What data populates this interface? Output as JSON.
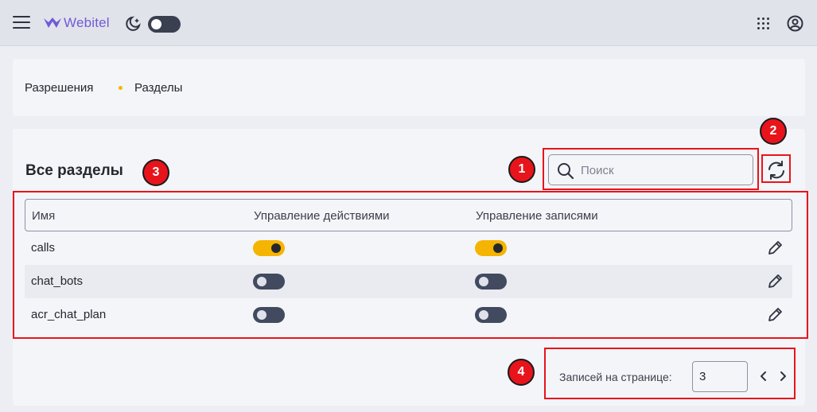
{
  "app": {
    "logo_text": "Webitel"
  },
  "breadcrumb": [
    "Разрешения",
    "Разделы"
  ],
  "page": {
    "title": "Все разделы"
  },
  "search": {
    "placeholder": "Поиск",
    "value": ""
  },
  "table": {
    "columns": [
      "Имя",
      "Управление действиями",
      "Управление записями"
    ],
    "rows": [
      {
        "name": "calls",
        "actions_enabled": true,
        "records_enabled": true
      },
      {
        "name": "chat_bots",
        "actions_enabled": false,
        "records_enabled": false
      },
      {
        "name": "acr_chat_plan",
        "actions_enabled": false,
        "records_enabled": false
      }
    ]
  },
  "pagination": {
    "label": "Записей на странице:",
    "per_page": "3"
  },
  "annotations": [
    "1",
    "2",
    "3",
    "4"
  ],
  "colors": {
    "accent": "#f5b400",
    "brand": "#6e5bd6",
    "annotation": "#e8141b",
    "switch_off": "#414a5e"
  },
  "icons": [
    "menu-icon",
    "webitel-logo-icon",
    "theme-moon-icon",
    "apps-grid-icon",
    "account-icon",
    "search-icon",
    "refresh-icon",
    "edit-pencil-icon",
    "chevron-left-icon",
    "chevron-right-icon"
  ]
}
